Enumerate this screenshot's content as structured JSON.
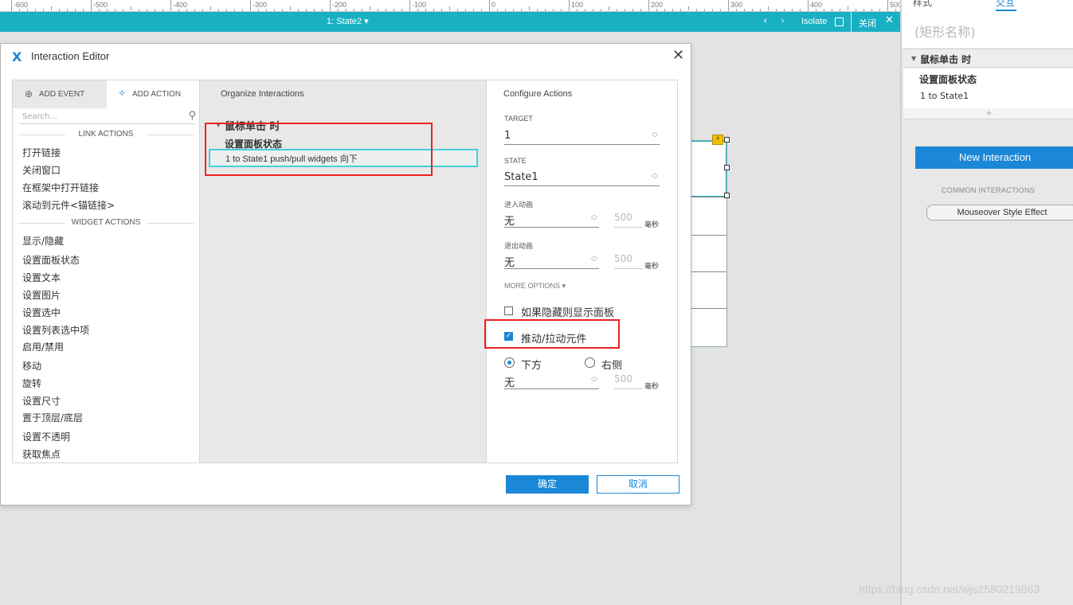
{
  "ruler": {
    "labels": [
      "-600",
      "-500",
      "-400",
      "-300",
      "-200",
      "-100",
      "0",
      "100",
      "200",
      "300",
      "400",
      "500"
    ]
  },
  "statebar": {
    "title": "1: State2 ▾",
    "isolate": "Isolate",
    "close": "关闭"
  },
  "right_panel": {
    "tab_style": "样式",
    "tab_interactions": "交互",
    "name_placeholder": "(矩形名称)",
    "event_label": "鼠标单击 时",
    "action_label": "设置面板状态",
    "action_detail": "1 to State1",
    "plus": "+",
    "new_interaction": "New Interaction",
    "common_interactions": "COMMON INTERACTIONS",
    "mouseover": "Mouseover Style Effect"
  },
  "dialog": {
    "title": "Interaction Editor",
    "left": {
      "tab_add_event": "ADD EVENT",
      "tab_add_action": "ADD ACTION",
      "search_placeholder": "Search...",
      "link_actions_header": "LINK ACTIONS",
      "link_actions": [
        "打开链接",
        "关闭窗口",
        "在框架中打开链接",
        "滚动到元件<锚链接>"
      ],
      "widget_actions_header": "WIDGET ACTIONS",
      "widget_actions": [
        "显示/隐藏",
        "设置面板状态",
        "设置文本",
        "设置图片",
        "设置选中",
        "设置列表选中项",
        "启用/禁用",
        "移动",
        "旋转",
        "设置尺寸",
        "置于顶层/底层",
        "设置不透明",
        "获取焦点"
      ]
    },
    "middle": {
      "header": "Organize Interactions",
      "event_label": "鼠标单击 时",
      "action_label": "设置面板状态",
      "action_detail": "1 to State1 push/pull widgets 向下"
    },
    "right": {
      "header": "Configure Actions",
      "target_label": "TARGET",
      "target_value": "1",
      "state_label": "STATE",
      "state_value": "State1",
      "enter_anim_label": "进入动画",
      "enter_anim_value": "无",
      "enter_ms": "500",
      "ms_unit": "毫秒",
      "exit_anim_label": "退出动画",
      "exit_anim_value": "无",
      "exit_ms": "500",
      "more_options": "MORE OPTIONS ▾",
      "show_if_hidden": "如果隐藏则显示面板",
      "show_if_hidden_checked": false,
      "push_pull": "推动/拉动元件",
      "push_pull_checked": true,
      "dir_below": "下方",
      "dir_right": "右侧",
      "dir_selected": "下方",
      "push_anim_value": "无",
      "push_ms": "500"
    },
    "ok": "确定",
    "cancel": "取消"
  },
  "watermark": "https://blog.csdn.net/wjs2580219863",
  "colors": {
    "accent": "#1a87d7",
    "teal": "#1ab0c4",
    "highlight": "#e22222"
  }
}
